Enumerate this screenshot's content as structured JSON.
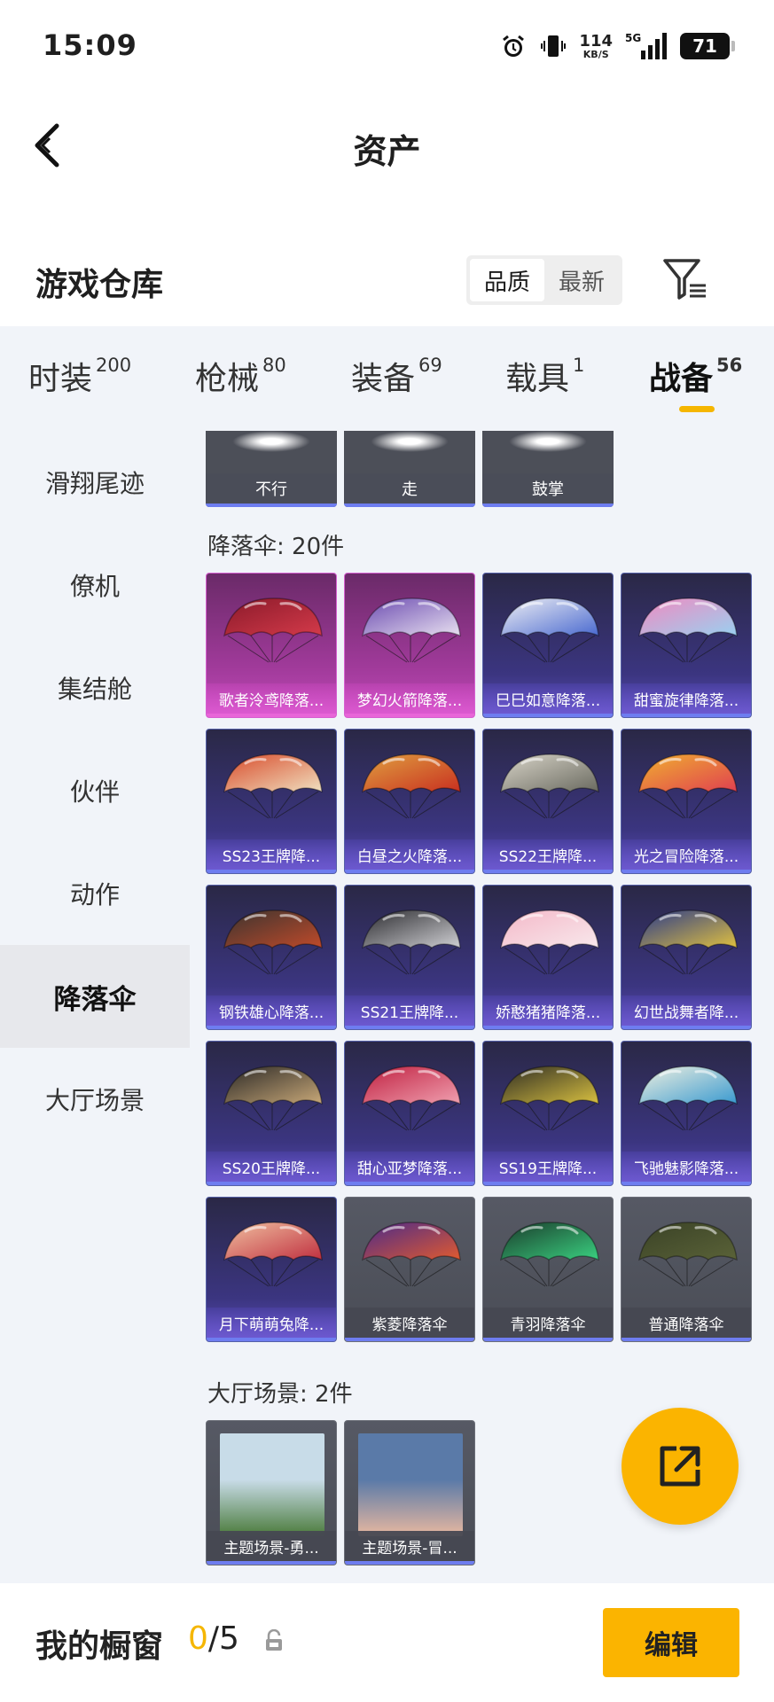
{
  "status_bar": {
    "time": "15:09",
    "net_speed_value": "114",
    "net_speed_unit": "KB/S",
    "net_label": "5G",
    "battery": "71",
    "icons": [
      "alarm-icon",
      "vibrate-icon",
      "signal-icon"
    ]
  },
  "nav": {
    "title": "资产",
    "back_icon": "chevron-left-icon"
  },
  "section": {
    "title": "游戏仓库",
    "sort_options": [
      "品质",
      "最新"
    ],
    "sort_selected": "品质",
    "filter_icon": "filter-icon"
  },
  "tabs": [
    {
      "label": "时装",
      "count": "200"
    },
    {
      "label": "枪械",
      "count": "80"
    },
    {
      "label": "装备",
      "count": "69"
    },
    {
      "label": "载具",
      "count": "1"
    },
    {
      "label": "战备",
      "count": "56",
      "active": true
    }
  ],
  "sidebar": [
    "滑翔尾迹",
    "僚机",
    "集结舱",
    "伙伴",
    "动作",
    "降落伞",
    "大厅场景"
  ],
  "sidebar_active": "降落伞",
  "actions_row": [
    "不行",
    "走",
    "鼓掌"
  ],
  "parachutes": {
    "title": "降落伞: 20件",
    "items": [
      {
        "name": "歌者泠鸢降落...",
        "rarity": "pink",
        "colors": [
          "#8a1a2a",
          "#d43a4a"
        ]
      },
      {
        "name": "梦幻火箭降落...",
        "rarity": "pink",
        "colors": [
          "#6a4ab0",
          "#e8e0f0"
        ]
      },
      {
        "name": "巳巳如意降落...",
        "rarity": "purple",
        "colors": [
          "#f0f0f4",
          "#4a6ad0"
        ]
      },
      {
        "name": "甜蜜旋律降落...",
        "rarity": "purple",
        "colors": [
          "#f08ac0",
          "#9ad0f0"
        ]
      },
      {
        "name": "SS23王牌降...",
        "rarity": "purple",
        "colors": [
          "#d84a2a",
          "#f0e0c0"
        ]
      },
      {
        "name": "白昼之火降落...",
        "rarity": "purple",
        "colors": [
          "#e0a040",
          "#c83020"
        ]
      },
      {
        "name": "SS22王牌降...",
        "rarity": "purple",
        "colors": [
          "#d8d4c8",
          "#6a6a60"
        ]
      },
      {
        "name": "光之冒险降落...",
        "rarity": "purple",
        "colors": [
          "#f0b030",
          "#e04050"
        ]
      },
      {
        "name": "钢铁雄心降落...",
        "rarity": "purple",
        "colors": [
          "#3a3430",
          "#c04a2a"
        ]
      },
      {
        "name": "SS21王牌降...",
        "rarity": "purple",
        "colors": [
          "#2a2a2e",
          "#d0d0d4"
        ]
      },
      {
        "name": "娇憨猪猪降落...",
        "rarity": "purple",
        "colors": [
          "#f4b8c8",
          "#f8e8ec"
        ]
      },
      {
        "name": "幻世战舞者降...",
        "rarity": "purple",
        "colors": [
          "#2a3a8a",
          "#e0c040"
        ]
      },
      {
        "name": "SS20王牌降...",
        "rarity": "purple",
        "colors": [
          "#2a2826",
          "#c8a878"
        ]
      },
      {
        "name": "甜心亚梦降落...",
        "rarity": "purple",
        "colors": [
          "#c02040",
          "#f0a0b0"
        ]
      },
      {
        "name": "SS19王牌降...",
        "rarity": "purple",
        "colors": [
          "#2e2c24",
          "#d8c040"
        ]
      },
      {
        "name": "飞驰魅影降落...",
        "rarity": "purple",
        "colors": [
          "#f0f0e0",
          "#3a9ad0"
        ]
      },
      {
        "name": "月下萌萌兔降...",
        "rarity": "purple",
        "colors": [
          "#f0c0a0",
          "#c03040"
        ]
      },
      {
        "name": "紫菱降落伞",
        "rarity": "gray",
        "colors": [
          "#4a2a8a",
          "#e05a30"
        ]
      },
      {
        "name": "青羽降落伞",
        "rarity": "gray",
        "colors": [
          "#1a3a2a",
          "#3ad080"
        ]
      },
      {
        "name": "普通降落伞",
        "rarity": "gray",
        "colors": [
          "#3a4226",
          "#5a6238"
        ]
      }
    ]
  },
  "scenes": {
    "title": "大厅场景: 2件",
    "items": [
      {
        "name": "主题场景-勇...",
        "colors": [
          "#c8dce8",
          "#4a7a3a"
        ]
      },
      {
        "name": "主题场景-冒...",
        "colors": [
          "#5a7aa8",
          "#e8b8a0"
        ]
      }
    ]
  },
  "fab": {
    "icon": "share-external-icon"
  },
  "bottom": {
    "label": "我的橱窗",
    "current": "0",
    "total": "/5",
    "lock_icon": "lock-icon",
    "edit_label": "编辑"
  }
}
